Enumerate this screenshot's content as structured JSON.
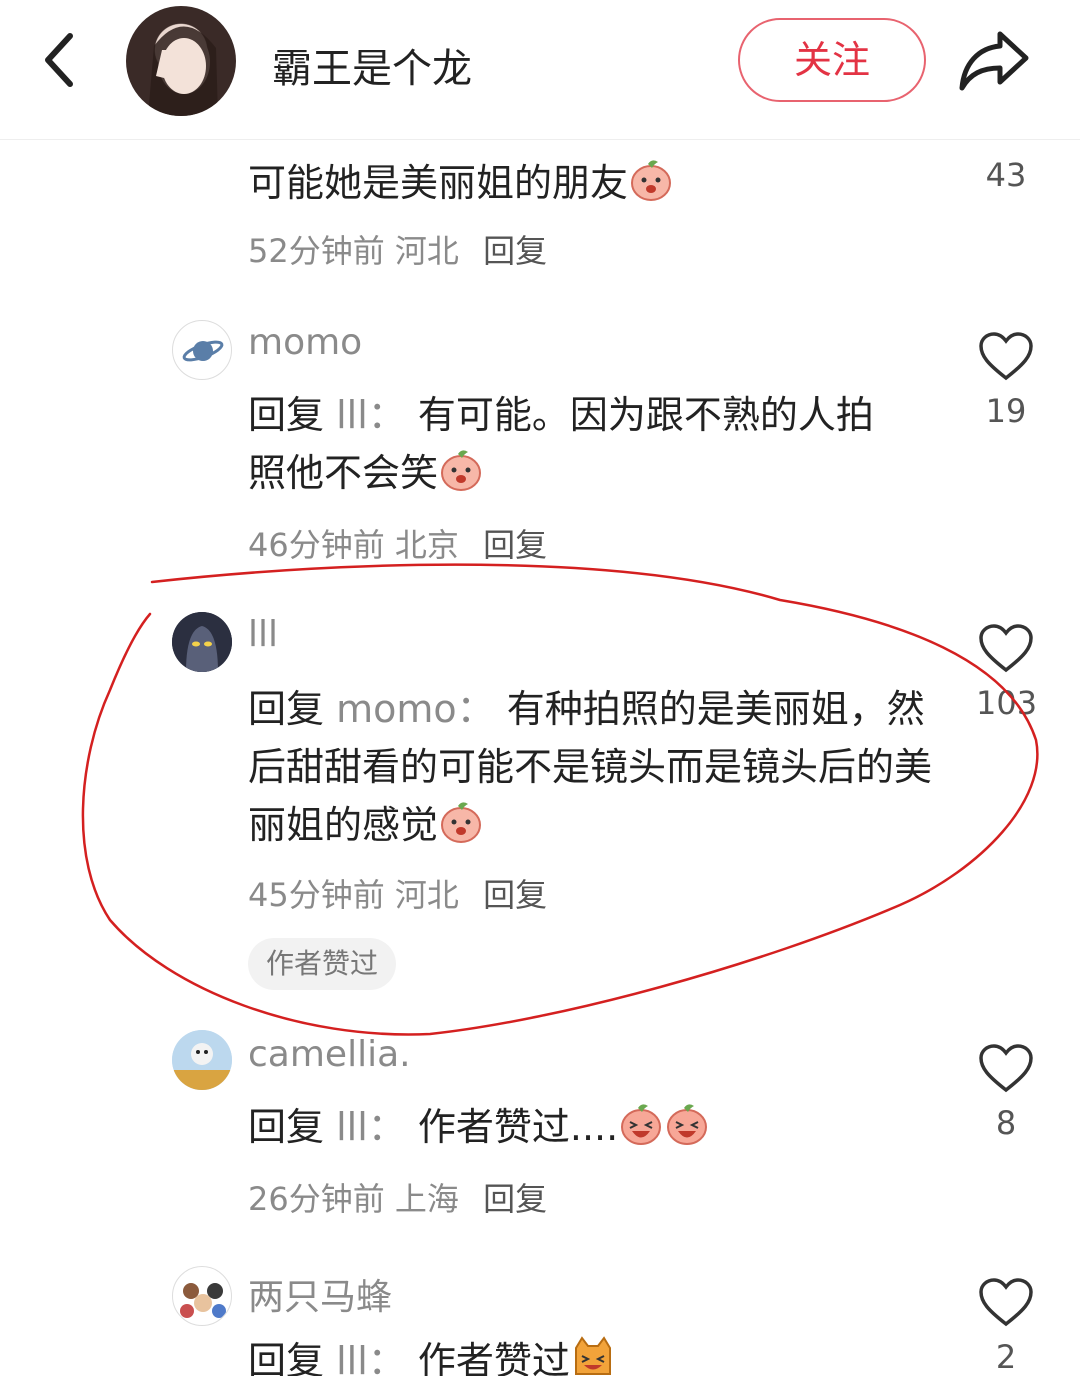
{
  "header": {
    "author_name": "霸王是个龙",
    "follow_label": "关注"
  },
  "comments": [
    {
      "text": "可能她是美丽姐的朋友",
      "time": "52分钟前",
      "location": "河北",
      "reply_label": "回复",
      "likes": "43"
    },
    {
      "username": "momo",
      "prefix": "回复",
      "reply_to": "lll：",
      "text": "有可能。因为跟不熟的人拍照他不会笑",
      "time": "46分钟前",
      "location": "北京",
      "reply_label": "回复",
      "likes": "19"
    },
    {
      "username": "lll",
      "prefix": "回复",
      "reply_to": "momo：",
      "text": "有种拍照的是美丽姐，然后甜甜看的可能不是镜头而是镜头后的美丽姐的感觉",
      "time": "45分钟前",
      "location": "河北",
      "reply_label": "回复",
      "likes": "103",
      "badge": "作者赞过"
    },
    {
      "username": "camellia.",
      "prefix": "回复",
      "reply_to": "lll：",
      "text": "作者赞过....",
      "time": "26分钟前",
      "location": "上海",
      "reply_label": "回复",
      "likes": "8"
    },
    {
      "username": "两只马蜂",
      "prefix": "回复",
      "reply_to": "lll：",
      "text": "作者赞过",
      "likes": "2"
    }
  ],
  "icons": {
    "back": "chevron-left-icon",
    "share": "share-arrow-icon",
    "like": "heart-outline-icon",
    "emoji": "peach-face-emoji"
  },
  "colors": {
    "follow": "#e33344",
    "annotation": "#d42020",
    "muted": "#8a8a8a"
  }
}
